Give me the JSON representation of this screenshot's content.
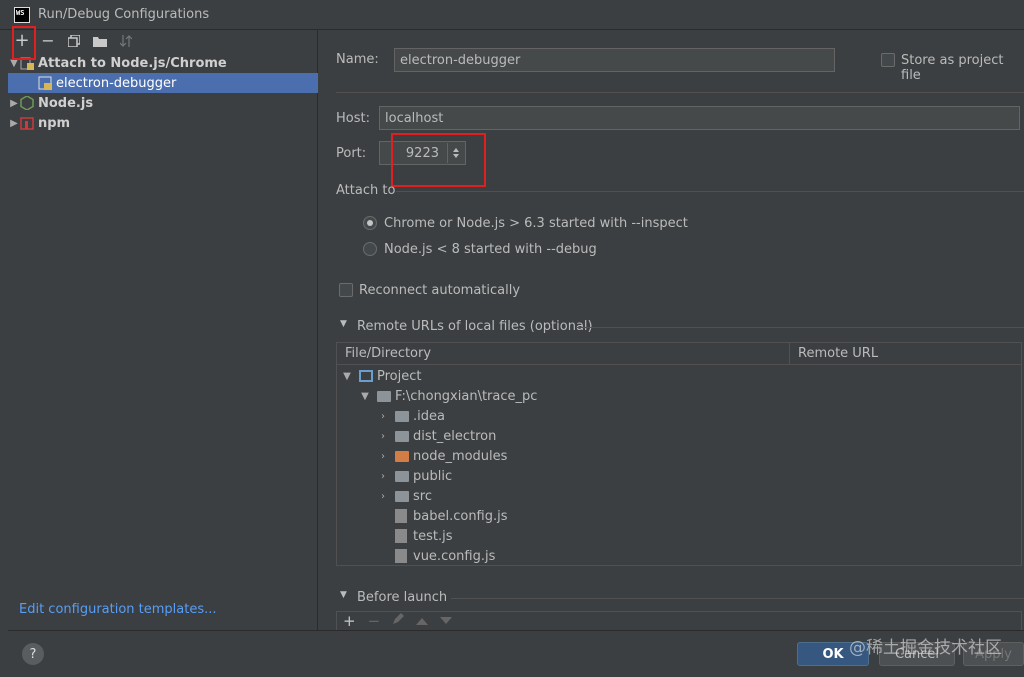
{
  "window": {
    "title": "Run/Debug Configurations",
    "logo_text": "WS"
  },
  "toolbar": {
    "add": "+",
    "remove": "−"
  },
  "tree": {
    "group": "Attach to Node.js/Chrome",
    "child": "electron-debugger",
    "node": "Node.js",
    "npm": "npm"
  },
  "edit_templates": "Edit configuration templates...",
  "form": {
    "name_label": "Name:",
    "name_value": "electron-debugger",
    "store_label": "Store as project file",
    "host_label": "Host:",
    "host_value": "localhost",
    "port_label": "Port:",
    "port_value": "9223",
    "attach_label": "Attach to",
    "radio1": "Chrome or Node.js > 6.3 started with --inspect",
    "radio2": "Node.js < 8 started with --debug",
    "reconnect": "Reconnect automatically",
    "remote_urls": "Remote URLs of local files (optional)",
    "col_file": "File/Directory",
    "col_remote": "Remote URL",
    "before_launch": "Before launch"
  },
  "files": {
    "project": "Project",
    "root": "F:\\chongxian\\trace_pc",
    "idea": ".idea",
    "dist": "dist_electron",
    "node_modules": "node_modules",
    "public": "public",
    "src": "src",
    "babel": "babel.config.js",
    "test": "test.js",
    "vue": "vue.config.js"
  },
  "buttons": {
    "ok": "OK",
    "cancel": "Cancel",
    "apply": "Apply"
  },
  "watermark": "@稀土掘金技术社区",
  "colors": {
    "selection": "#4b6eaf",
    "link": "#589df6",
    "highlight_box": "#e02020"
  }
}
